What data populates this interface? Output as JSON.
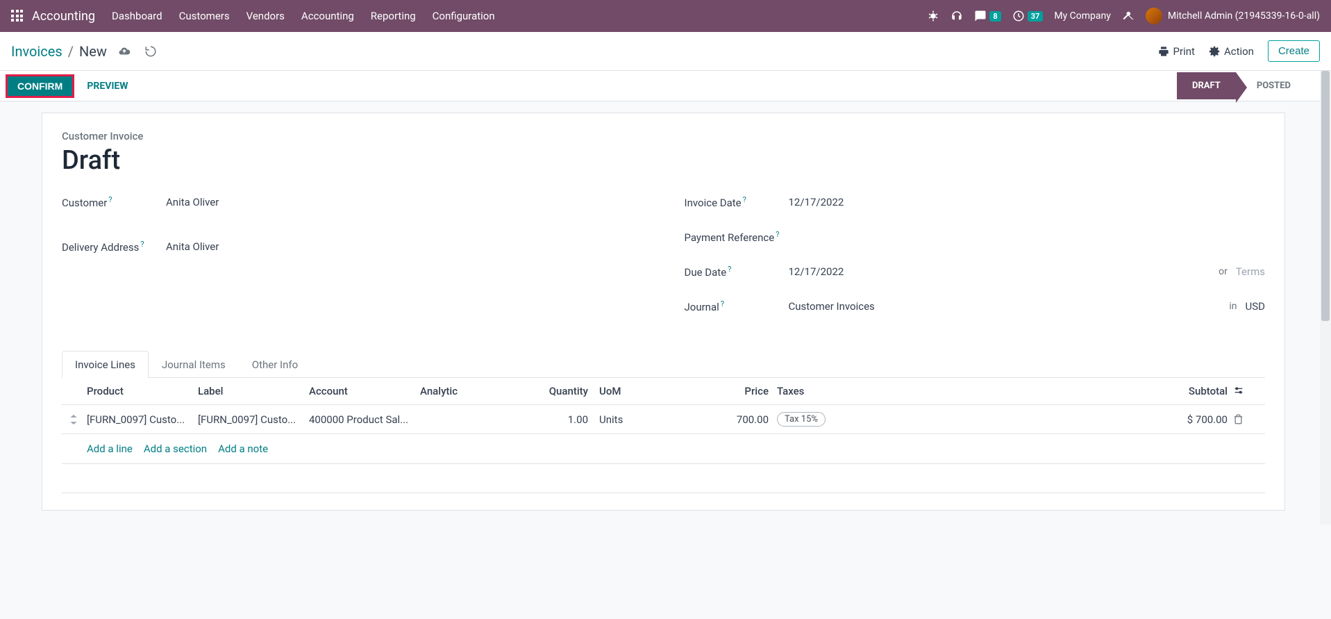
{
  "topnav": {
    "brand": "Accounting",
    "menu": [
      "Dashboard",
      "Customers",
      "Vendors",
      "Accounting",
      "Reporting",
      "Configuration"
    ],
    "chat_count": "8",
    "activity_count": "37",
    "company": "My Company",
    "user": "Mitchell Admin (21945339-16-0-all)"
  },
  "breadcrumb": {
    "root": "Invoices",
    "current": "New"
  },
  "actions": {
    "print": "Print",
    "action": "Action",
    "create": "Create"
  },
  "statusbar": {
    "confirm": "CONFIRM",
    "preview": "PREVIEW",
    "draft": "DRAFT",
    "posted": "POSTED"
  },
  "sheet": {
    "title": "Customer Invoice",
    "h1": "Draft",
    "left": [
      {
        "label": "Customer",
        "help": "?",
        "value": "Anita Oliver"
      },
      {
        "label": "Delivery Address",
        "help": "?",
        "value": "Anita Oliver"
      }
    ],
    "right": [
      {
        "label": "Invoice Date",
        "help": "?",
        "value": "12/17/2022"
      },
      {
        "label": "Payment Reference",
        "help": "?",
        "value": ""
      },
      {
        "label": "Due Date",
        "help": "?",
        "value": "12/17/2022",
        "extra_pre": "or",
        "extra_val": "Terms",
        "extra_muted": true
      },
      {
        "label": "Journal",
        "help": "?",
        "value": "Customer Invoices",
        "extra_pre": "in",
        "extra_val": "USD"
      }
    ]
  },
  "tabs": [
    "Invoice Lines",
    "Journal Items",
    "Other Info"
  ],
  "table": {
    "headers": {
      "product": "Product",
      "label": "Label",
      "account": "Account",
      "analytic": "Analytic",
      "qty": "Quantity",
      "uom": "UoM",
      "price": "Price",
      "taxes": "Taxes",
      "subtotal": "Subtotal"
    },
    "rows": [
      {
        "product": "[FURN_0097] Custo...",
        "label": "[FURN_0097] Custo...",
        "account": "400000 Product Sal...",
        "analytic": "",
        "qty": "1.00",
        "uom": "Units",
        "price": "700.00",
        "tax": "Tax 15%",
        "subtotal": "$ 700.00"
      }
    ],
    "add": {
      "line": "Add a line",
      "section": "Add a section",
      "note": "Add a note"
    }
  }
}
